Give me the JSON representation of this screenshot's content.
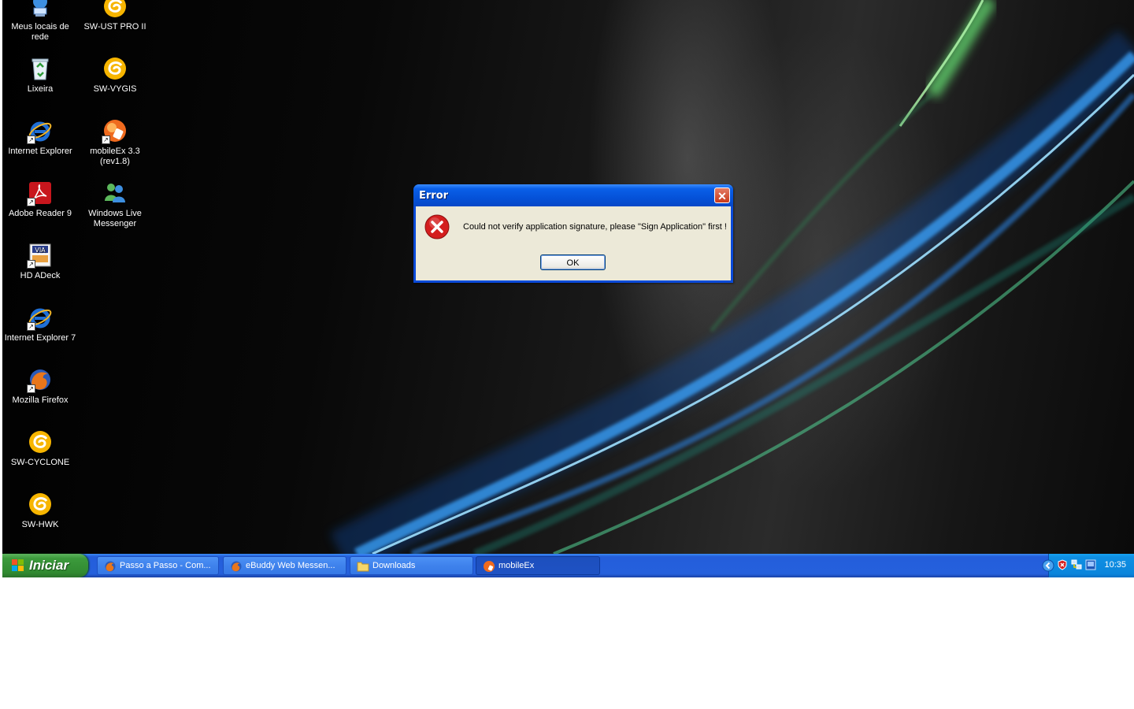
{
  "desktop": {
    "icons": [
      {
        "label": "Meus locais de rede",
        "icon": "network-places-icon"
      },
      {
        "label": "SW-UST PRO II",
        "icon": "swirl-app-icon"
      },
      {
        "label": "Lixeira",
        "icon": "recycle-bin-icon"
      },
      {
        "label": "SW-VYGIS",
        "icon": "swirl-app-icon"
      },
      {
        "label": "Internet Explorer",
        "icon": "internet-explorer-icon"
      },
      {
        "label": "mobileEx 3.3 (rev1.8)",
        "icon": "mobileex-icon"
      },
      {
        "label": "Adobe Reader 9",
        "icon": "adobe-reader-icon"
      },
      {
        "label": "Windows Live Messenger",
        "icon": "messenger-icon"
      },
      {
        "label": "HD ADeck",
        "icon": "hd-adeck-icon"
      },
      {
        "label": "Internet Explorer 7",
        "icon": "internet-explorer-icon"
      },
      {
        "label": "Mozilla Firefox",
        "icon": "firefox-icon"
      },
      {
        "label": "SW-CYCLONE",
        "icon": "swirl-app-icon"
      },
      {
        "label": "SW-HWK",
        "icon": "swirl-app-icon"
      }
    ]
  },
  "dialog": {
    "title": "Error",
    "message": "Could not verify application signature, please \"Sign Application\" first !",
    "ok_label": "OK",
    "icon": "error-icon",
    "close_icon": "close-icon",
    "close_glyph": "✕"
  },
  "taskbar": {
    "start_label": "Iniciar",
    "tasks": [
      {
        "label": "Passo a Passo - Com...",
        "icon": "firefox-icon",
        "active": false
      },
      {
        "label": "eBuddy Web Messen...",
        "icon": "firefox-icon",
        "active": false
      },
      {
        "label": "Downloads",
        "icon": "folder-icon",
        "active": false
      },
      {
        "label": "mobileEx",
        "icon": "mobileex-icon",
        "active": true
      }
    ],
    "clock": "10:35",
    "tray_icons": [
      "show-hidden-icons-chevron",
      "security-shield-icon",
      "network-icon",
      "app-tray-icon"
    ]
  },
  "colors": {
    "taskbar_blue": "#245edb",
    "start_green": "#3c9a3c",
    "dialog_blue": "#0a4ad8",
    "dialog_face": "#ece9d8",
    "error_red": "#d41e1e"
  }
}
